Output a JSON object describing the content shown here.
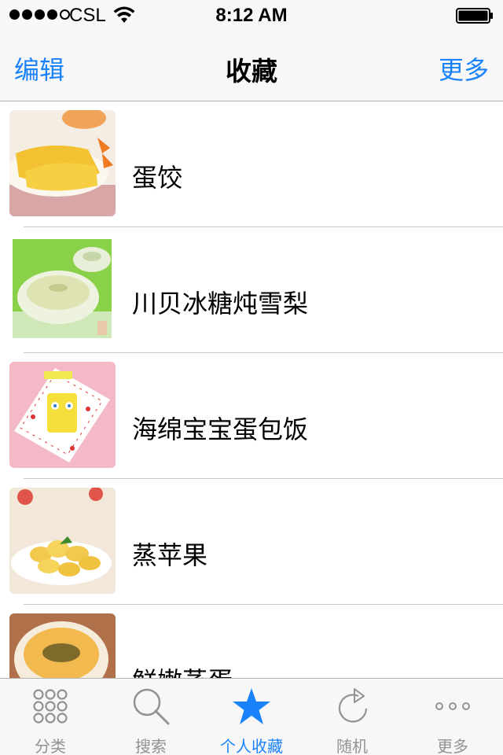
{
  "status_bar": {
    "carrier": "CSL",
    "time": "8:12 AM",
    "signal_bars_filled": 4,
    "signal_bars_total": 5
  },
  "nav": {
    "left_label": "编辑",
    "title": "收藏",
    "right_label": "更多"
  },
  "favorites": [
    {
      "title": "蛋饺"
    },
    {
      "title": "川贝冰糖炖雪梨"
    },
    {
      "title": "海绵宝宝蛋包饭"
    },
    {
      "title": "蒸苹果"
    },
    {
      "title": "鲜嫩蒸蛋"
    }
  ],
  "tabs": [
    {
      "label": "分类",
      "icon": "grid-icon"
    },
    {
      "label": "搜索",
      "icon": "search-icon"
    },
    {
      "label": "个人收藏",
      "icon": "star-icon",
      "active": true
    },
    {
      "label": "随机",
      "icon": "refresh-icon"
    },
    {
      "label": "更多",
      "icon": "more-icon"
    }
  ],
  "colors": {
    "accent": "#1a82fb",
    "inactive": "#929292",
    "bar_bg": "#f7f7f7"
  }
}
